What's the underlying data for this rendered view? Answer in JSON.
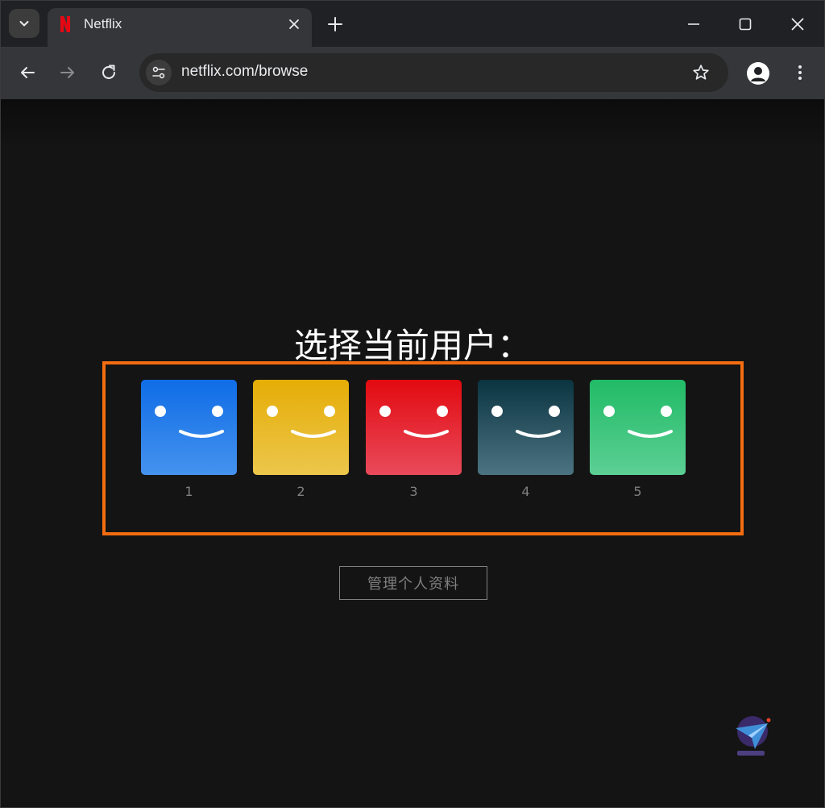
{
  "browser": {
    "tab": {
      "title": "Netflix"
    },
    "address_bar": {
      "url": "netflix.com/browse"
    }
  },
  "page": {
    "heading": "选择当前用户：",
    "profiles": [
      {
        "name": "1",
        "color": "#1c74e9"
      },
      {
        "name": "2",
        "color": "#e6b10d"
      },
      {
        "name": "3",
        "color": "#e50914"
      },
      {
        "name": "4",
        "color": "#0c3a47"
      },
      {
        "name": "5",
        "color": "#29c06e"
      }
    ],
    "manage_button": "管理个人资料"
  },
  "colors": {
    "highlight_border": "#f36d10",
    "page_background": "#141414"
  }
}
